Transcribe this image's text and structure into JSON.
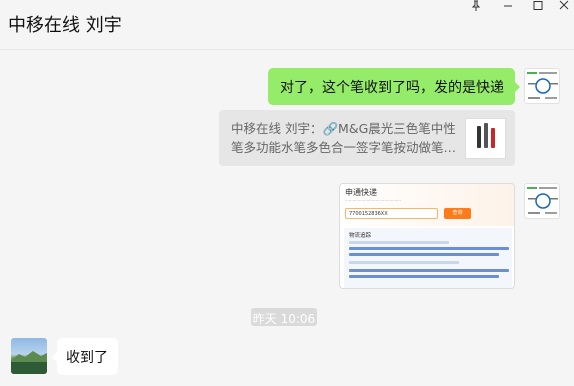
{
  "header": {
    "chat_title": "中移在线 刘宇",
    "buttons": {
      "pin_icon": "pin-icon",
      "minimize_icon": "minimize-icon",
      "maximize_icon": "maximize-icon",
      "close_icon": "close-icon"
    }
  },
  "messages": {
    "sent_text": "对了，这个笔收到了吗，发的是快递",
    "quote": {
      "text": "中移在线 刘宇：🔗M&G晨光三色笔中性笔多功能水笔多色合一签字笔按动做笔…"
    },
    "tracking_screenshot": {
      "title": "申通快递",
      "number": "7700152836XX",
      "button": "查询",
      "section": "物流追踪"
    },
    "timestamp": "昨天 10:06",
    "received_text": "收到了"
  },
  "colors": {
    "sent_bubble": "#95ec69",
    "received_bubble": "#ffffff",
    "background": "#f5f5f5"
  }
}
